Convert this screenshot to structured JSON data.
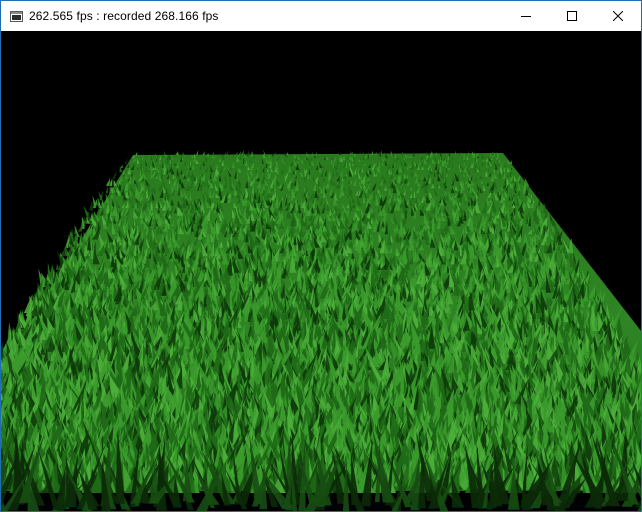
{
  "window": {
    "title": "262.565 fps : recorded 268.166 fps",
    "app_icon": "app-window-icon",
    "controls": {
      "minimize_icon": "minimize-icon",
      "maximize_icon": "maximize-icon",
      "close_icon": "close-icon"
    }
  },
  "scene": {
    "background_color": "#000000",
    "grass_colors": {
      "dark": "#0e3a0a",
      "mid": "#1f6a17",
      "light": "#3a9a2c",
      "highlight": "#4cae3a"
    }
  }
}
